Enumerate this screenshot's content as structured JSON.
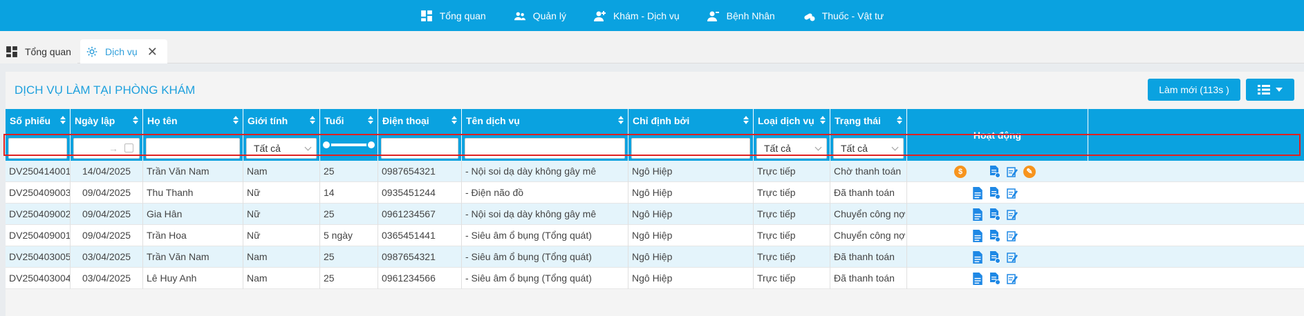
{
  "topnav": {
    "items": [
      {
        "label": "Tổng quan",
        "icon": "dashboard-icon"
      },
      {
        "label": "Quản lý",
        "icon": "users-icon"
      },
      {
        "label": "Khám - Dịch vụ",
        "icon": "user-medical-icon"
      },
      {
        "label": "Bệnh Nhân",
        "icon": "patient-icon"
      },
      {
        "label": "Thuốc - Vật tư",
        "icon": "medicine-icon"
      }
    ]
  },
  "tabs": [
    {
      "label": "Tổng quan",
      "icon": "dashboard-icon",
      "active": false
    },
    {
      "label": "Dịch vụ",
      "icon": "gear-icon",
      "active": true,
      "close": "✕"
    }
  ],
  "panel": {
    "title": "DỊCH VỤ LÀM TẠI PHÒNG KHÁM",
    "refresh_label": "Làm mới (113s )",
    "columns_icon": "list-icon"
  },
  "table": {
    "headers": {
      "so_phieu": "Số phiếu",
      "ngay_lap": "Ngày lập",
      "ho_ten": "Họ tên",
      "gioi_tinh": "Giới tính",
      "tuoi": "Tuổi",
      "dien_thoai": "Điện thoại",
      "ten_dich_vu": "Tên dịch vụ",
      "chi_dinh_boi": "Chỉ định bởi",
      "loai_dich_vu": "Loại dịch vụ",
      "trang_thai": "Trạng thái",
      "hoat_dong": "Hoạt động"
    },
    "filters": {
      "gioi_tinh": "Tất cả",
      "loai_dich_vu": "Tất cả",
      "trang_thai": "Tất cả",
      "date_arrow": "→"
    },
    "rows": [
      {
        "so_phieu": "DV250414001",
        "ngay_lap": "14/04/2025",
        "ho_ten": "Trần Văn Nam",
        "gioi_tinh": "Nam",
        "tuoi": "25",
        "dien_thoai": "0987654321",
        "ten_dich_vu": "- Nội soi dạ dày không gây mê",
        "chi_dinh_boi": "Ngô Hiệp",
        "loai_dich_vu": "Trực tiếp",
        "trang_thai": "Chờ thanh toán",
        "status": "pending"
      },
      {
        "so_phieu": "DV250409003",
        "ngay_lap": "09/04/2025",
        "ho_ten": "Thu Thanh",
        "gioi_tinh": "Nữ",
        "tuoi": "14",
        "dien_thoai": "0935451244",
        "ten_dich_vu": "- Điện não đồ",
        "chi_dinh_boi": "Ngô Hiệp",
        "loai_dich_vu": "Trực tiếp",
        "trang_thai": "Đã thanh toán",
        "status": "paid"
      },
      {
        "so_phieu": "DV250409002",
        "ngay_lap": "09/04/2025",
        "ho_ten": "Gia Hân",
        "gioi_tinh": "Nữ",
        "tuoi": "25",
        "dien_thoai": "0961234567",
        "ten_dich_vu": "- Nội soi dạ dày không gây mê",
        "chi_dinh_boi": "Ngô Hiệp",
        "loai_dich_vu": "Trực tiếp",
        "trang_thai": "Chuyển công nợ",
        "status": "debt"
      },
      {
        "so_phieu": "DV250409001",
        "ngay_lap": "09/04/2025",
        "ho_ten": "Trần Hoa",
        "gioi_tinh": "Nữ",
        "tuoi": "5 ngày",
        "dien_thoai": "0365451441",
        "ten_dich_vu": "- Siêu âm ổ bụng (Tổng quát)",
        "chi_dinh_boi": "Ngô Hiệp",
        "loai_dich_vu": "Trực tiếp",
        "trang_thai": "Chuyển công nợ",
        "status": "debt"
      },
      {
        "so_phieu": "DV250403005",
        "ngay_lap": "03/04/2025",
        "ho_ten": "Trần Văn Nam",
        "gioi_tinh": "Nam",
        "tuoi": "25",
        "dien_thoai": "0987654321",
        "ten_dich_vu": "- Siêu âm ổ bụng (Tổng quát)",
        "chi_dinh_boi": "Ngô Hiệp",
        "loai_dich_vu": "Trực tiếp",
        "trang_thai": "Đã thanh toán",
        "status": "paid"
      },
      {
        "so_phieu": "DV250403004",
        "ngay_lap": "03/04/2025",
        "ho_ten": "Lê Huy Anh",
        "gioi_tinh": "Nam",
        "tuoi": "25",
        "dien_thoai": "0961234566",
        "ten_dich_vu": "- Siêu âm ổ bụng (Tổng quát)",
        "chi_dinh_boi": "Ngô Hiệp",
        "loai_dich_vu": "Trực tiếp",
        "trang_thai": "Đã thanh toán",
        "status": "paid"
      }
    ]
  },
  "colors": {
    "primary": "#0aa2e0",
    "pending": "#f0953a",
    "paid": "#2e9a3a",
    "debt": "#e5262b",
    "highlight": "#e02020"
  }
}
